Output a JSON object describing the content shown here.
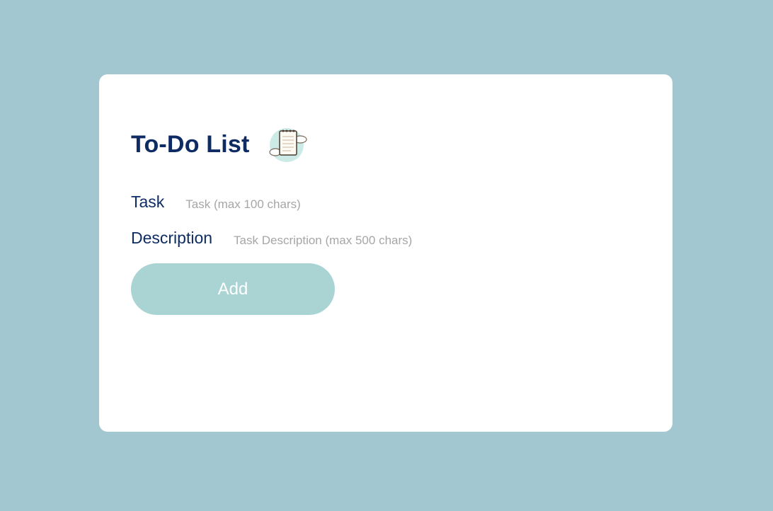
{
  "app": {
    "title": "To-Do List",
    "icon": "notebook-icon"
  },
  "form": {
    "task_label": "Task",
    "task_placeholder": "Task (max 100 chars)",
    "task_value": "",
    "description_label": "Description",
    "description_placeholder": "Task Description (max 500 chars)",
    "description_value": "",
    "add_label": "Add"
  },
  "colors": {
    "background": "#a3c7d0",
    "card": "#ffffff",
    "title": "#0e2c63",
    "button": "#aad4d4",
    "placeholder": "#a6a6a6"
  }
}
